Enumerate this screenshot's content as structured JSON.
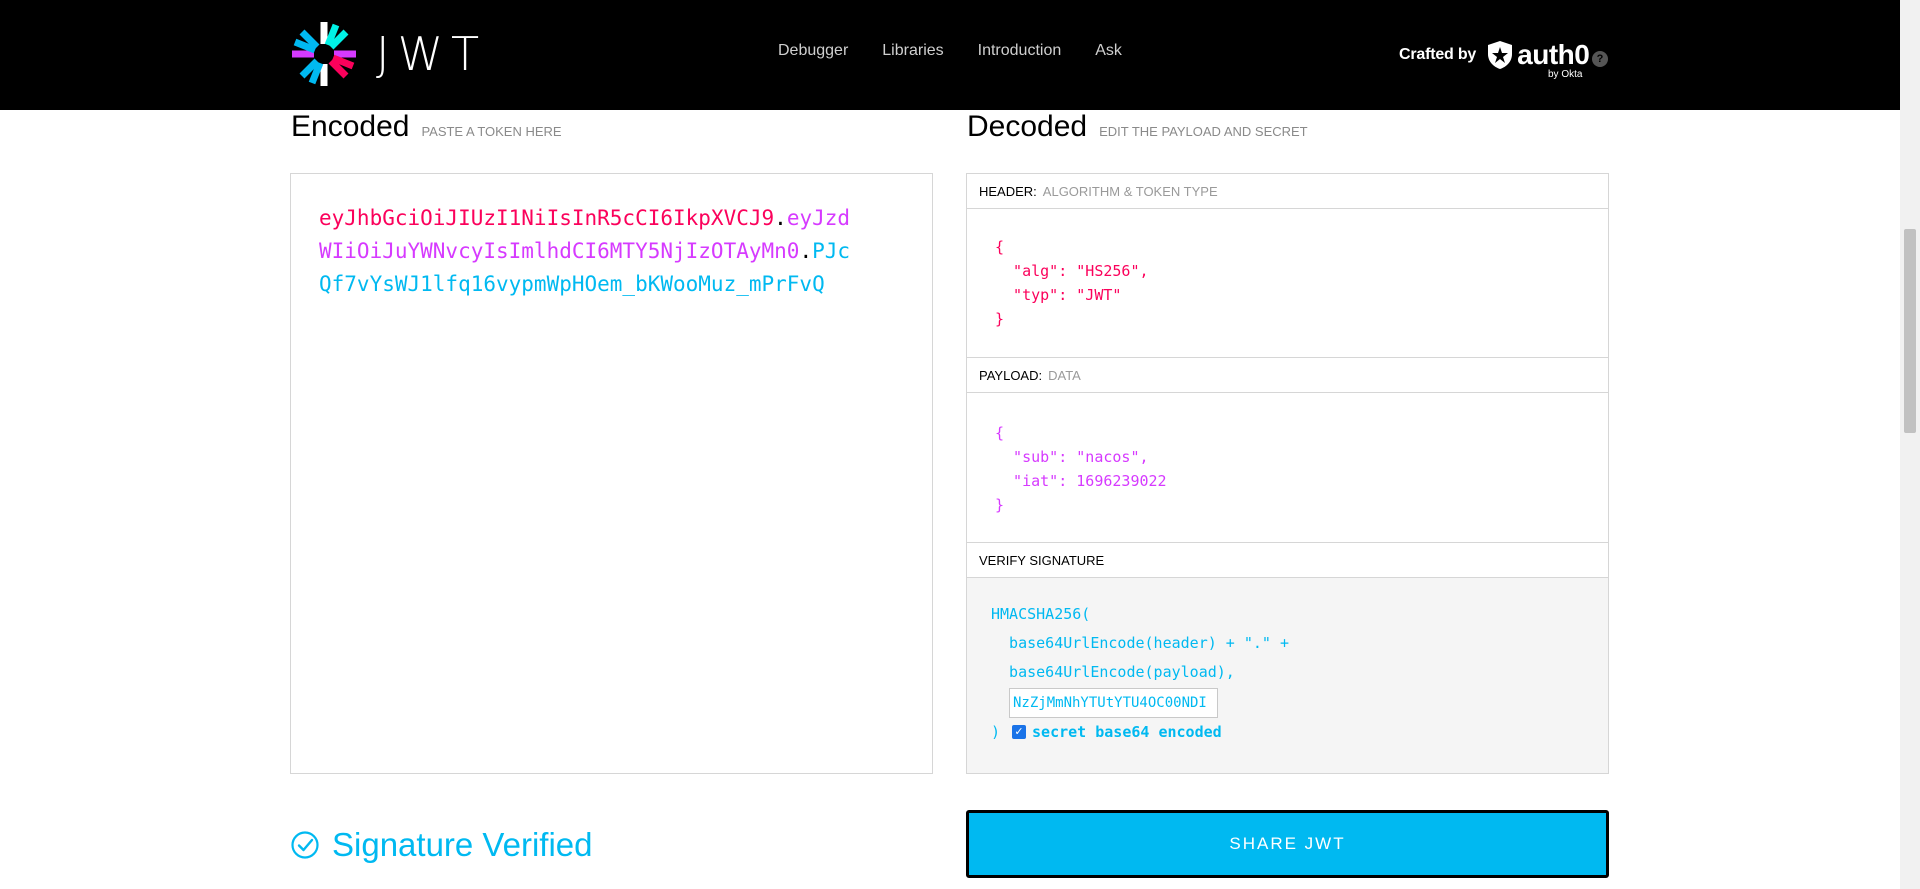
{
  "navbar": {
    "logo_text": "JWT",
    "links": [
      "Debugger",
      "Libraries",
      "Introduction",
      "Ask"
    ],
    "crafted_by": "Crafted by",
    "brand": "auth0",
    "brand_sub": "by Okta",
    "help": "?"
  },
  "encoded": {
    "title": "Encoded",
    "subtitle": "PASTE A TOKEN HERE",
    "token_header": "eyJhbGciOiJIUzI1NiIsInR5cCI6IkpXVCJ9",
    "token_payload": "eyJzdWIiOiJuYWNvcyIsImlhdCI6MTY5NjIzOTAyMn0",
    "token_signature": "PJcQf7vYsWJ1lfq16vypmWpHOem_bKWooMuz_mPrFvQ",
    "dot": "."
  },
  "decoded": {
    "title": "Decoded",
    "subtitle": "EDIT THE PAYLOAD AND SECRET",
    "header_label": "HEADER:",
    "header_sub": "ALGORITHM & TOKEN TYPE",
    "header_json": "{\n  \"alg\": \"HS256\",\n  \"typ\": \"JWT\"\n}",
    "payload_label": "PAYLOAD:",
    "payload_sub": "DATA",
    "payload_json": "{\n  \"sub\": \"nacos\",\n  \"iat\": 1696239022\n}",
    "verify_label": "VERIFY SIGNATURE",
    "verify_line1": "HMACSHA256(",
    "verify_line2": "  base64UrlEncode(header) + \".\" +",
    "verify_line3": "  base64UrlEncode(payload),",
    "secret_value": "NzZjMmNhYTUtYTU4OC00NDI",
    "close_paren": ")",
    "checkbox_mark": "✓",
    "secret_label": "secret base64 encoded"
  },
  "status": {
    "verified_text": "Signature Verified"
  },
  "share": {
    "label": "SHARE JWT"
  },
  "colors": {
    "header": "#fb015b",
    "payload": "#d63aff",
    "signature": "#00b9f1"
  }
}
